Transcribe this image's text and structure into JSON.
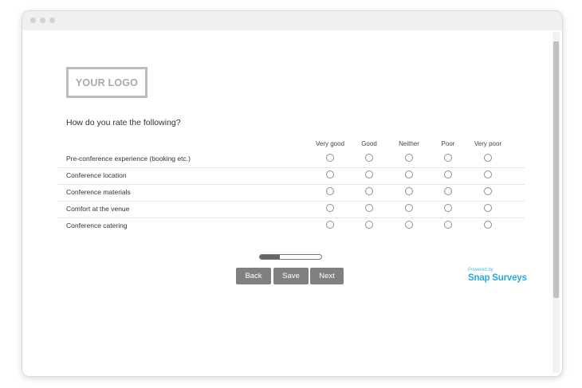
{
  "logo": {
    "text": "YOUR LOGO"
  },
  "survey": {
    "question": "How do you rate the following?",
    "columns": [
      "Very good",
      "Good",
      "Neither",
      "Poor",
      "Very poor"
    ],
    "rows": [
      "Pre-conference experience (booking etc.)",
      "Conference location",
      "Conference materials",
      "Comfort at the venue",
      "Conference catering"
    ]
  },
  "progress": {
    "fraction": 0.33
  },
  "buttons": {
    "back": "Back",
    "save": "Save",
    "next": "Next"
  },
  "branding": {
    "powered": "Powered by",
    "name": "Snap Surveys"
  },
  "colors": {
    "button": "#808080",
    "brand": "#29a8dc"
  }
}
